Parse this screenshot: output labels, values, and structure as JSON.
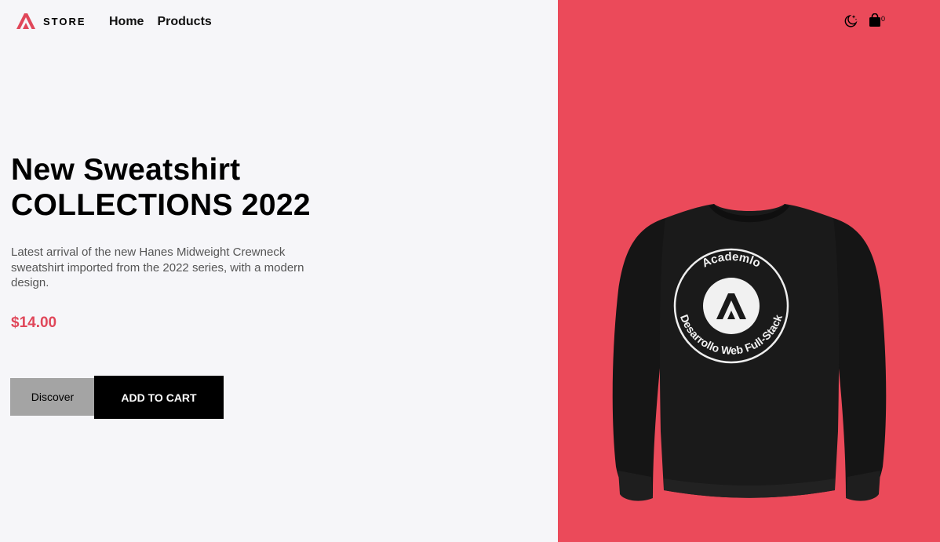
{
  "header": {
    "logo_icon": "academlo-logo-icon",
    "logo_text": "STORE",
    "nav": [
      {
        "label": "Home"
      },
      {
        "label": "Products"
      }
    ],
    "theme_icon": "moon-stars-icon",
    "cart_icon": "shopping-bag-icon",
    "cart_count": "0"
  },
  "hero": {
    "title_line1": "New Sweatshirt",
    "title_line2": "COLLECTIONS 2022",
    "description": "Latest arrival of the new Hanes Midweight Crewneck sweatshirt imported from the 2022 series, with a modern design.",
    "price": "$14.00",
    "discover_label": "Discover",
    "add_to_cart_label": "ADD TO CART"
  },
  "product": {
    "image_icon": "sweatshirt-image",
    "print_top_text": "Academlo",
    "print_bottom_text": "Desarrollo Web Full-Stack"
  },
  "colors": {
    "accent": "#eb4a5a",
    "price": "#e0475a",
    "background": "#f6f6f9",
    "discover_button": "#a4a4a4",
    "cart_button": "#000000"
  }
}
